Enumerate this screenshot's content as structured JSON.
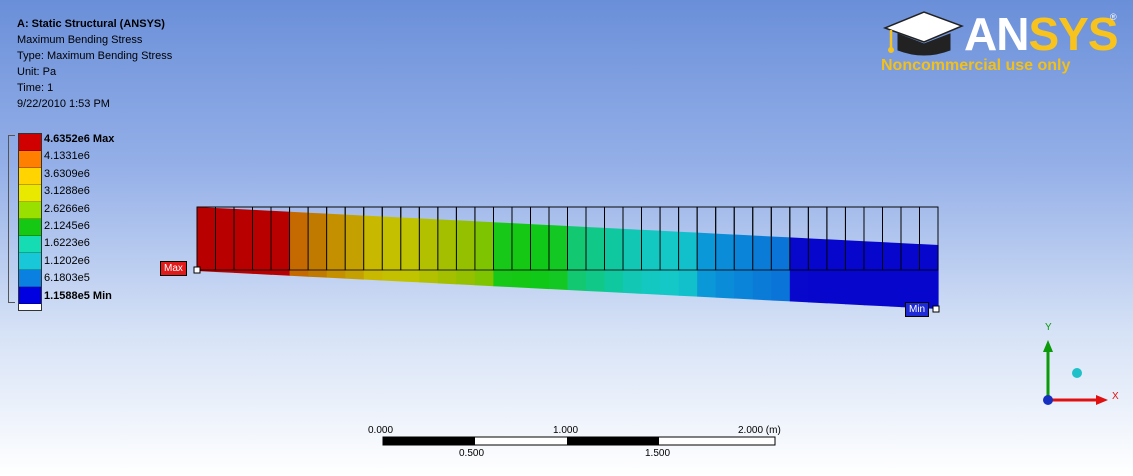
{
  "info": {
    "title": "A: Static Structural (ANSYS)",
    "result_name": "Maximum Bending Stress",
    "type": "Type: Maximum Bending Stress",
    "unit": "Unit: Pa",
    "time": "Time: 1",
    "timestamp": "9/22/2010 1:53 PM"
  },
  "logo": {
    "brand_an": "AN",
    "brand_sys": "SYS",
    "registered": "®",
    "note": "Noncommercial use only",
    "brand_colors": {
      "text": "#ffffff",
      "accent": "#f7c31c"
    }
  },
  "legend": {
    "labels": [
      "4.6352e6 Max",
      "4.1331e6",
      "3.6309e6",
      "3.1288e6",
      "2.6266e6",
      "2.1245e6",
      "1.6223e6",
      "1.1202e6",
      "6.1803e5",
      "1.1588e5 Min"
    ],
    "colors": [
      "#d00000",
      "#ff7f00",
      "#ffd400",
      "#e9e900",
      "#99e000",
      "#14c814",
      "#16dcb4",
      "#18c8d8",
      "#0a80e0",
      "#0000e0"
    ]
  },
  "probes": {
    "max_label": "Max",
    "min_label": "Min"
  },
  "scale_bar": {
    "top_labels": [
      "0.000",
      "1.000",
      "2.000 (m)"
    ],
    "bottom_labels": [
      "0.500",
      "1.500"
    ]
  },
  "triad": {
    "y_label": "Y",
    "x_label": "X",
    "colors": {
      "y_axis": "#0a9a0a",
      "x_axis": "#e01010",
      "origin": "#1530c0",
      "ball": "#20c0c8"
    }
  },
  "beam": {
    "segment_colors": [
      "#b80000",
      "#b80000",
      "#b80000",
      "#b80000",
      "#b80000",
      "#c46a00",
      "#c07a00",
      "#c49000",
      "#c4a000",
      "#c8b800",
      "#c4c000",
      "#c0c400",
      "#b2c000",
      "#a4be00",
      "#94c000",
      "#7ec400",
      "#18c818",
      "#14c814",
      "#10c818",
      "#14c824",
      "#12c870",
      "#10c888",
      "#10c8a0",
      "#12c8b4",
      "#12c8c0",
      "#14c8c8",
      "#12c0cc",
      "#0a98d8",
      "#0a8cd8",
      "#0a84d8",
      "#0a7cd8",
      "#0a74d8",
      "#0808cc",
      "#0606cc",
      "#0606cc",
      "#0606cc",
      "#0606cc",
      "#0606cc",
      "#0606cc",
      "#0606cc"
    ]
  }
}
